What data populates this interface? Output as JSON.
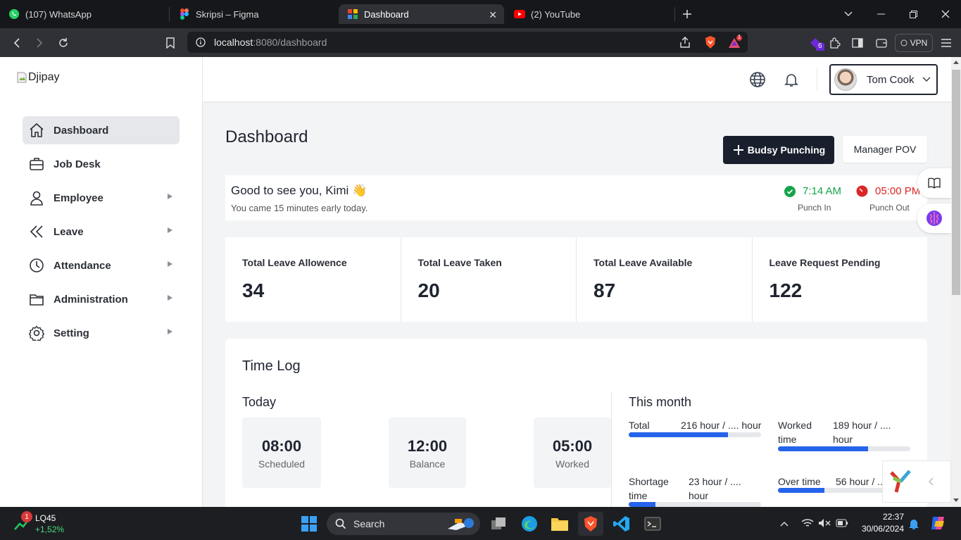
{
  "browser": {
    "tabs": [
      {
        "title": "(107) WhatsApp",
        "icon": "whatsapp-icon"
      },
      {
        "title": "Skripsi – Figma",
        "icon": "figma-icon"
      },
      {
        "title": "Dashboard",
        "icon": "dashboard-favicon",
        "active": true
      },
      {
        "title": "(2) YouTube",
        "icon": "youtube-icon"
      }
    ],
    "url_host": "localhost",
    "url_path": ":8080/dashboard",
    "extension_badge": "6",
    "rewards_badge": "1",
    "vpn_label": "VPN"
  },
  "sidebar": {
    "logo_alt": "Djipay",
    "items": [
      {
        "label": "Dashboard",
        "icon": "home-icon",
        "active": true,
        "submenu": false
      },
      {
        "label": "Job Desk",
        "icon": "briefcase-icon",
        "submenu": false
      },
      {
        "label": "Employee",
        "icon": "user-icon",
        "submenu": true
      },
      {
        "label": "Leave",
        "icon": "double-chevron-left-icon",
        "submenu": true
      },
      {
        "label": "Attendance",
        "icon": "clock-icon",
        "submenu": true
      },
      {
        "label": "Administration",
        "icon": "folder-icon",
        "submenu": true
      },
      {
        "label": "Setting",
        "icon": "gear-icon",
        "submenu": true
      }
    ]
  },
  "header": {
    "user_name": "Tom Cook"
  },
  "dashboard": {
    "title": "Dashboard",
    "punch_button": "Budsy Punching",
    "manager_button": "Manager POV",
    "greeting": "Good to see you, Kimi",
    "greeting_emoji": "👋",
    "greeting_sub": "You came 15 minutes early today.",
    "punch_in_time": "7:14 AM",
    "punch_in_label": "Punch In",
    "punch_out_time": "05:00 PM",
    "punch_out_label": "Punch Out",
    "colors": {
      "punch_in": "#16a34a",
      "punch_out": "#dc2626",
      "accent": "#2563eb",
      "dark": "#1a1f2e"
    }
  },
  "stats": [
    {
      "label": "Total Leave Allowence",
      "value": "34"
    },
    {
      "label": "Total Leave Taken",
      "value": "20"
    },
    {
      "label": "Total Leave Available",
      "value": "87"
    },
    {
      "label": "Leave Request Pending",
      "value": "122"
    }
  ],
  "time_log": {
    "title": "Time Log",
    "today_title": "Today",
    "today": [
      {
        "value": "08:00",
        "label": "Scheduled"
      },
      {
        "value": "12:00",
        "label": "Balance"
      },
      {
        "value": "05:00",
        "label": "Worked"
      }
    ],
    "month_title": "This month",
    "month": [
      {
        "label": "Total",
        "value": "216 hour / .... hour",
        "progress": 0.75
      },
      {
        "label": "Worked time",
        "value": "189 hour / .... hour",
        "progress": 0.68
      },
      {
        "label": "Shortage time",
        "value": "23 hour / .... hour",
        "progress": 0.2
      },
      {
        "label": "Over time",
        "value": "56 hour / ....",
        "progress": 0.35
      }
    ]
  },
  "taskbar": {
    "stock_name": "LQ45",
    "stock_change": "+1,52%",
    "stock_badge": "1",
    "search_label": "Search",
    "time": "22:37",
    "date": "30/06/2024"
  }
}
